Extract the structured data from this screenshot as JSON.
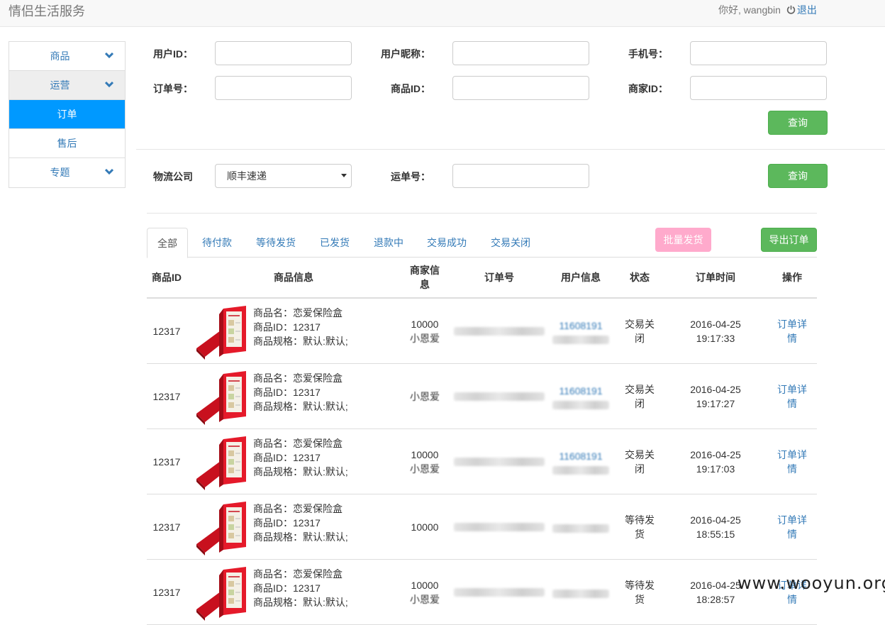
{
  "header": {
    "brand": "情侣生活服务",
    "greeting": "你好, wangbin",
    "logout": "退出"
  },
  "sidebar": {
    "items": [
      {
        "label": "商品"
      },
      {
        "label": "运营"
      },
      {
        "label": "订单"
      },
      {
        "label": "售后"
      },
      {
        "label": "专题"
      }
    ]
  },
  "search": {
    "user_id_label": "用户ID：",
    "nickname_label": "用户昵称：",
    "phone_label": "手机号：",
    "order_no_label": "订单号：",
    "product_id_label": "商品ID：",
    "merchant_id_label": "商家ID：",
    "query_button": "查询"
  },
  "logistics": {
    "company_label": "物流公司",
    "company_value": "顺丰速递",
    "waybill_label": "运单号：",
    "query_button": "查询"
  },
  "tabs": [
    "全部",
    "待付款",
    "等待发货",
    "已发货",
    "退款中",
    "交易成功",
    "交易关闭"
  ],
  "actions": {
    "batch_ship": "批量发货",
    "export": "导出订单"
  },
  "table": {
    "headers": [
      "商品ID",
      "商品信息",
      "商家信息",
      "订单号",
      "用户信息",
      "状态",
      "订单时间",
      "操作"
    ],
    "product_name_prefix": "商品名：",
    "product_id_prefix": "商品ID：",
    "product_spec_prefix": "商品规格：",
    "rows": [
      {
        "pid": "12317",
        "name": "恋爱保险盒",
        "spec": "默认:默认;",
        "merchant1": "10000",
        "merchant2": "小恩爱",
        "user1": "11608191",
        "status1": "交易关",
        "status2": "闭",
        "date": "2016-04-25",
        "time": "19:17:33",
        "op1": "订单详",
        "op2": "情"
      },
      {
        "pid": "12317",
        "name": "恋爱保险盒",
        "spec": "默认:默认;",
        "merchant1": "",
        "merchant2": "小恩爱",
        "user1": "11608191",
        "status1": "交易关",
        "status2": "闭",
        "date": "2016-04-25",
        "time": "19:17:27",
        "op1": "订单详",
        "op2": "情"
      },
      {
        "pid": "12317",
        "name": "恋爱保险盒",
        "spec": "默认:默认;",
        "merchant1": "10000",
        "merchant2": "小恩爱",
        "user1": "11608191",
        "status1": "交易关",
        "status2": "闭",
        "date": "2016-04-25",
        "time": "19:17:03",
        "op1": "订单详",
        "op2": "情"
      },
      {
        "pid": "12317",
        "name": "恋爱保险盒",
        "spec": "默认:默认;",
        "merchant1": "10000",
        "merchant2": "",
        "user1": "",
        "status1": "等待发",
        "status2": "货",
        "date": "2016-04-25",
        "time": "18:55:15",
        "op1": "订单详",
        "op2": "情"
      },
      {
        "pid": "12317",
        "name": "恋爱保险盒",
        "spec": "默认:默认;",
        "merchant1": "10000",
        "merchant2": "小恩爱",
        "user1": "",
        "status1": "等待发",
        "status2": "货",
        "date": "2016-04-25",
        "time": "18:28:57",
        "op1": "订单详",
        "op2": "情"
      }
    ]
  },
  "watermark": "www.wooyun.org",
  "colors": {
    "primary": "#337ab7",
    "active_nav": "#0099ff",
    "green": "#5cb85c",
    "pink": "#ffaacc"
  }
}
